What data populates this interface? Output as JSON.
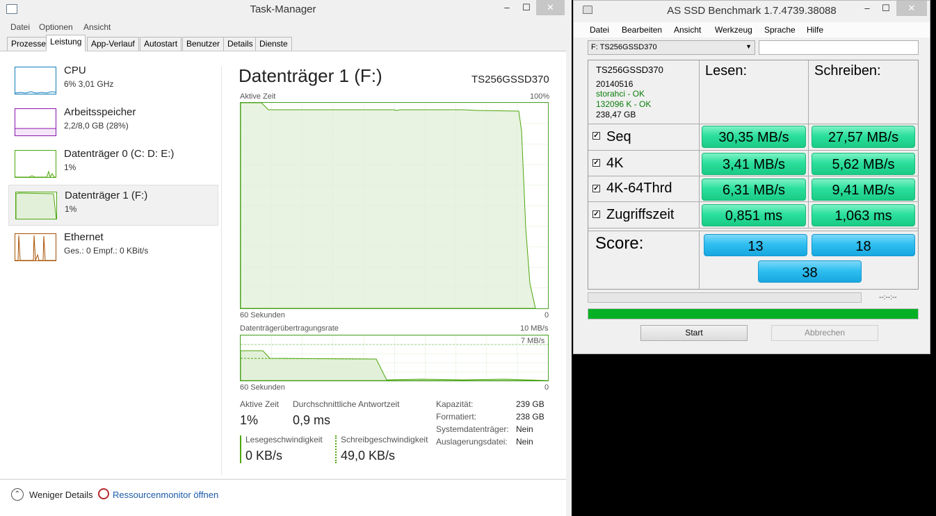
{
  "taskmanager": {
    "title": "Task-Manager",
    "window_buttons": {
      "minimize": "–",
      "maximize": "☐",
      "close": "✕"
    },
    "menu": [
      "Datei",
      "Optionen",
      "Ansicht"
    ],
    "tabs": [
      "Prozesse",
      "Leistung",
      "App-Verlauf",
      "Autostart",
      "Benutzer",
      "Details",
      "Dienste"
    ],
    "active_tab": "Leistung",
    "sidebar": [
      {
        "name": "CPU",
        "sub": "6% 3,01 GHz",
        "color": "#117dbb"
      },
      {
        "name": "Arbeitsspeicher",
        "sub": "2,2/8,0 GB (28%)",
        "color": "#8b12ae"
      },
      {
        "name": "Datenträger 0 (C: D: E:)",
        "sub": "1%",
        "color": "#4da60c"
      },
      {
        "name": "Datenträger 1 (F:)",
        "sub": "1%",
        "color": "#4da60c",
        "selected": true
      },
      {
        "name": "Ethernet",
        "sub": "Ges.: 0 Empf.: 0 KBit/s",
        "color": "#a74f01"
      }
    ],
    "detail": {
      "title": "Datenträger 1 (F:)",
      "model": "TS256GSSD370",
      "graph1": {
        "label": "Aktive Zeit",
        "max": "100%",
        "xlabel": "60 Sekunden",
        "xmin": "0"
      },
      "graph2": {
        "label": "Datenträgerübertragungsrate",
        "max": "10 MB/s",
        "inner": "7 MB/s",
        "xlabel": "60 Sekunden",
        "xmin": "0"
      },
      "stats": {
        "active_time_label": "Aktive Zeit",
        "active_time": "1%",
        "response_label": "Durchschnittliche Antwortzeit",
        "response": "0,9 ms",
        "read_label": "Lesegeschwindigkeit",
        "read": "0 KB/s",
        "write_label": "Schreibgeschwindigkeit",
        "write": "49,0 KB/s"
      },
      "properties": [
        {
          "k": "Kapazität:",
          "v": "239 GB"
        },
        {
          "k": "Formatiert:",
          "v": "238 GB"
        },
        {
          "k": "Systemdatenträger:",
          "v": "Nein"
        },
        {
          "k": "Auslagerungsdatei:",
          "v": "Nein"
        }
      ]
    },
    "footer": {
      "less_details": "Weniger Details",
      "resource_monitor": "Ressourcenmonitor öffnen"
    }
  },
  "asssd": {
    "title": "AS SSD Benchmark 1.7.4739.38088",
    "window_buttons": {
      "minimize": "–",
      "maximize": "☐",
      "close": "✕"
    },
    "menu": [
      "Datei",
      "Bearbeiten",
      "Ansicht",
      "Werkzeug",
      "Sprache",
      "Hilfe"
    ],
    "drive_select": "F: TS256GSSD370",
    "drive_info": {
      "model": "TS256GSSD370",
      "firmware": "20140516",
      "driver": "storahci - OK",
      "alignment": "132096 K - OK",
      "size": "238,47 GB"
    },
    "headers": {
      "read": "Lesen:",
      "write": "Schreiben:"
    },
    "rows": [
      {
        "label": "Seq",
        "checked": true,
        "read": "30,35 MB/s",
        "write": "27,57 MB/s"
      },
      {
        "label": "4K",
        "checked": true,
        "read": "3,41 MB/s",
        "write": "5,62 MB/s"
      },
      {
        "label": "4K-64Thrd",
        "checked": true,
        "read": "6,31 MB/s",
        "write": "9,41 MB/s"
      },
      {
        "label": "Zugriffszeit",
        "checked": true,
        "read": "0,851 ms",
        "write": "1,063 ms"
      }
    ],
    "score": {
      "label": "Score:",
      "read": "13",
      "write": "18",
      "total": "38"
    },
    "time": "--:--:--",
    "progress": 1.0,
    "progress_color": "#06b025",
    "buttons": {
      "start": "Start",
      "abort": "Abbrechen"
    },
    "check_glyph": "✓"
  }
}
